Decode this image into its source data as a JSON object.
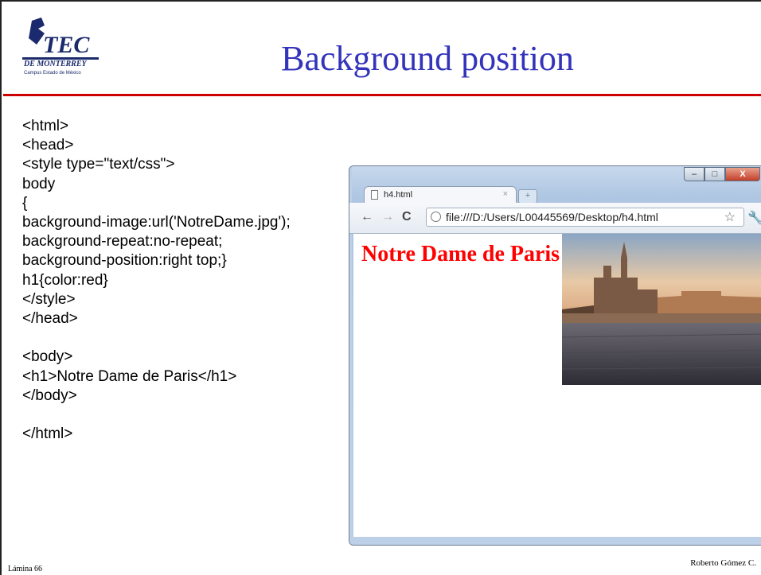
{
  "slide": {
    "title": "Background position",
    "logo": {
      "text": "TEC",
      "subtext": "DE MONTERREY",
      "campus": "Campus Estado de México"
    },
    "code_lines": [
      "<html>",
      "<head>",
      "<style type=\"text/css\">",
      "body",
      "{",
      "background-image:url('NotreDame.jpg');",
      "background-repeat:no-repeat;",
      "background-position:right top;}",
      "h1{color:red}",
      "</style>",
      "</head>",
      "",
      "<body>",
      "<h1>Notre Dame de Paris</h1>",
      "</body>",
      "",
      "</html>"
    ],
    "footer_left": "Lámina 66",
    "footer_right": "Roberto Gómez C.",
    "accent_color": "#cc0000",
    "title_color": "#3333bb"
  },
  "browser": {
    "tab_title": "h4.html",
    "tab_close": "×",
    "new_tab": "+",
    "url": "file:///D:/Users/L00445569/Desktop/h4.html",
    "page_heading": "Notre Dame de Paris",
    "page_heading_color": "#ff0000",
    "buttons": {
      "minimize": "–",
      "maximize": "□",
      "close": "X"
    },
    "icons": {
      "back": "←",
      "forward": "→",
      "reload": "C",
      "star": "☆",
      "wrench": "🔧"
    }
  }
}
